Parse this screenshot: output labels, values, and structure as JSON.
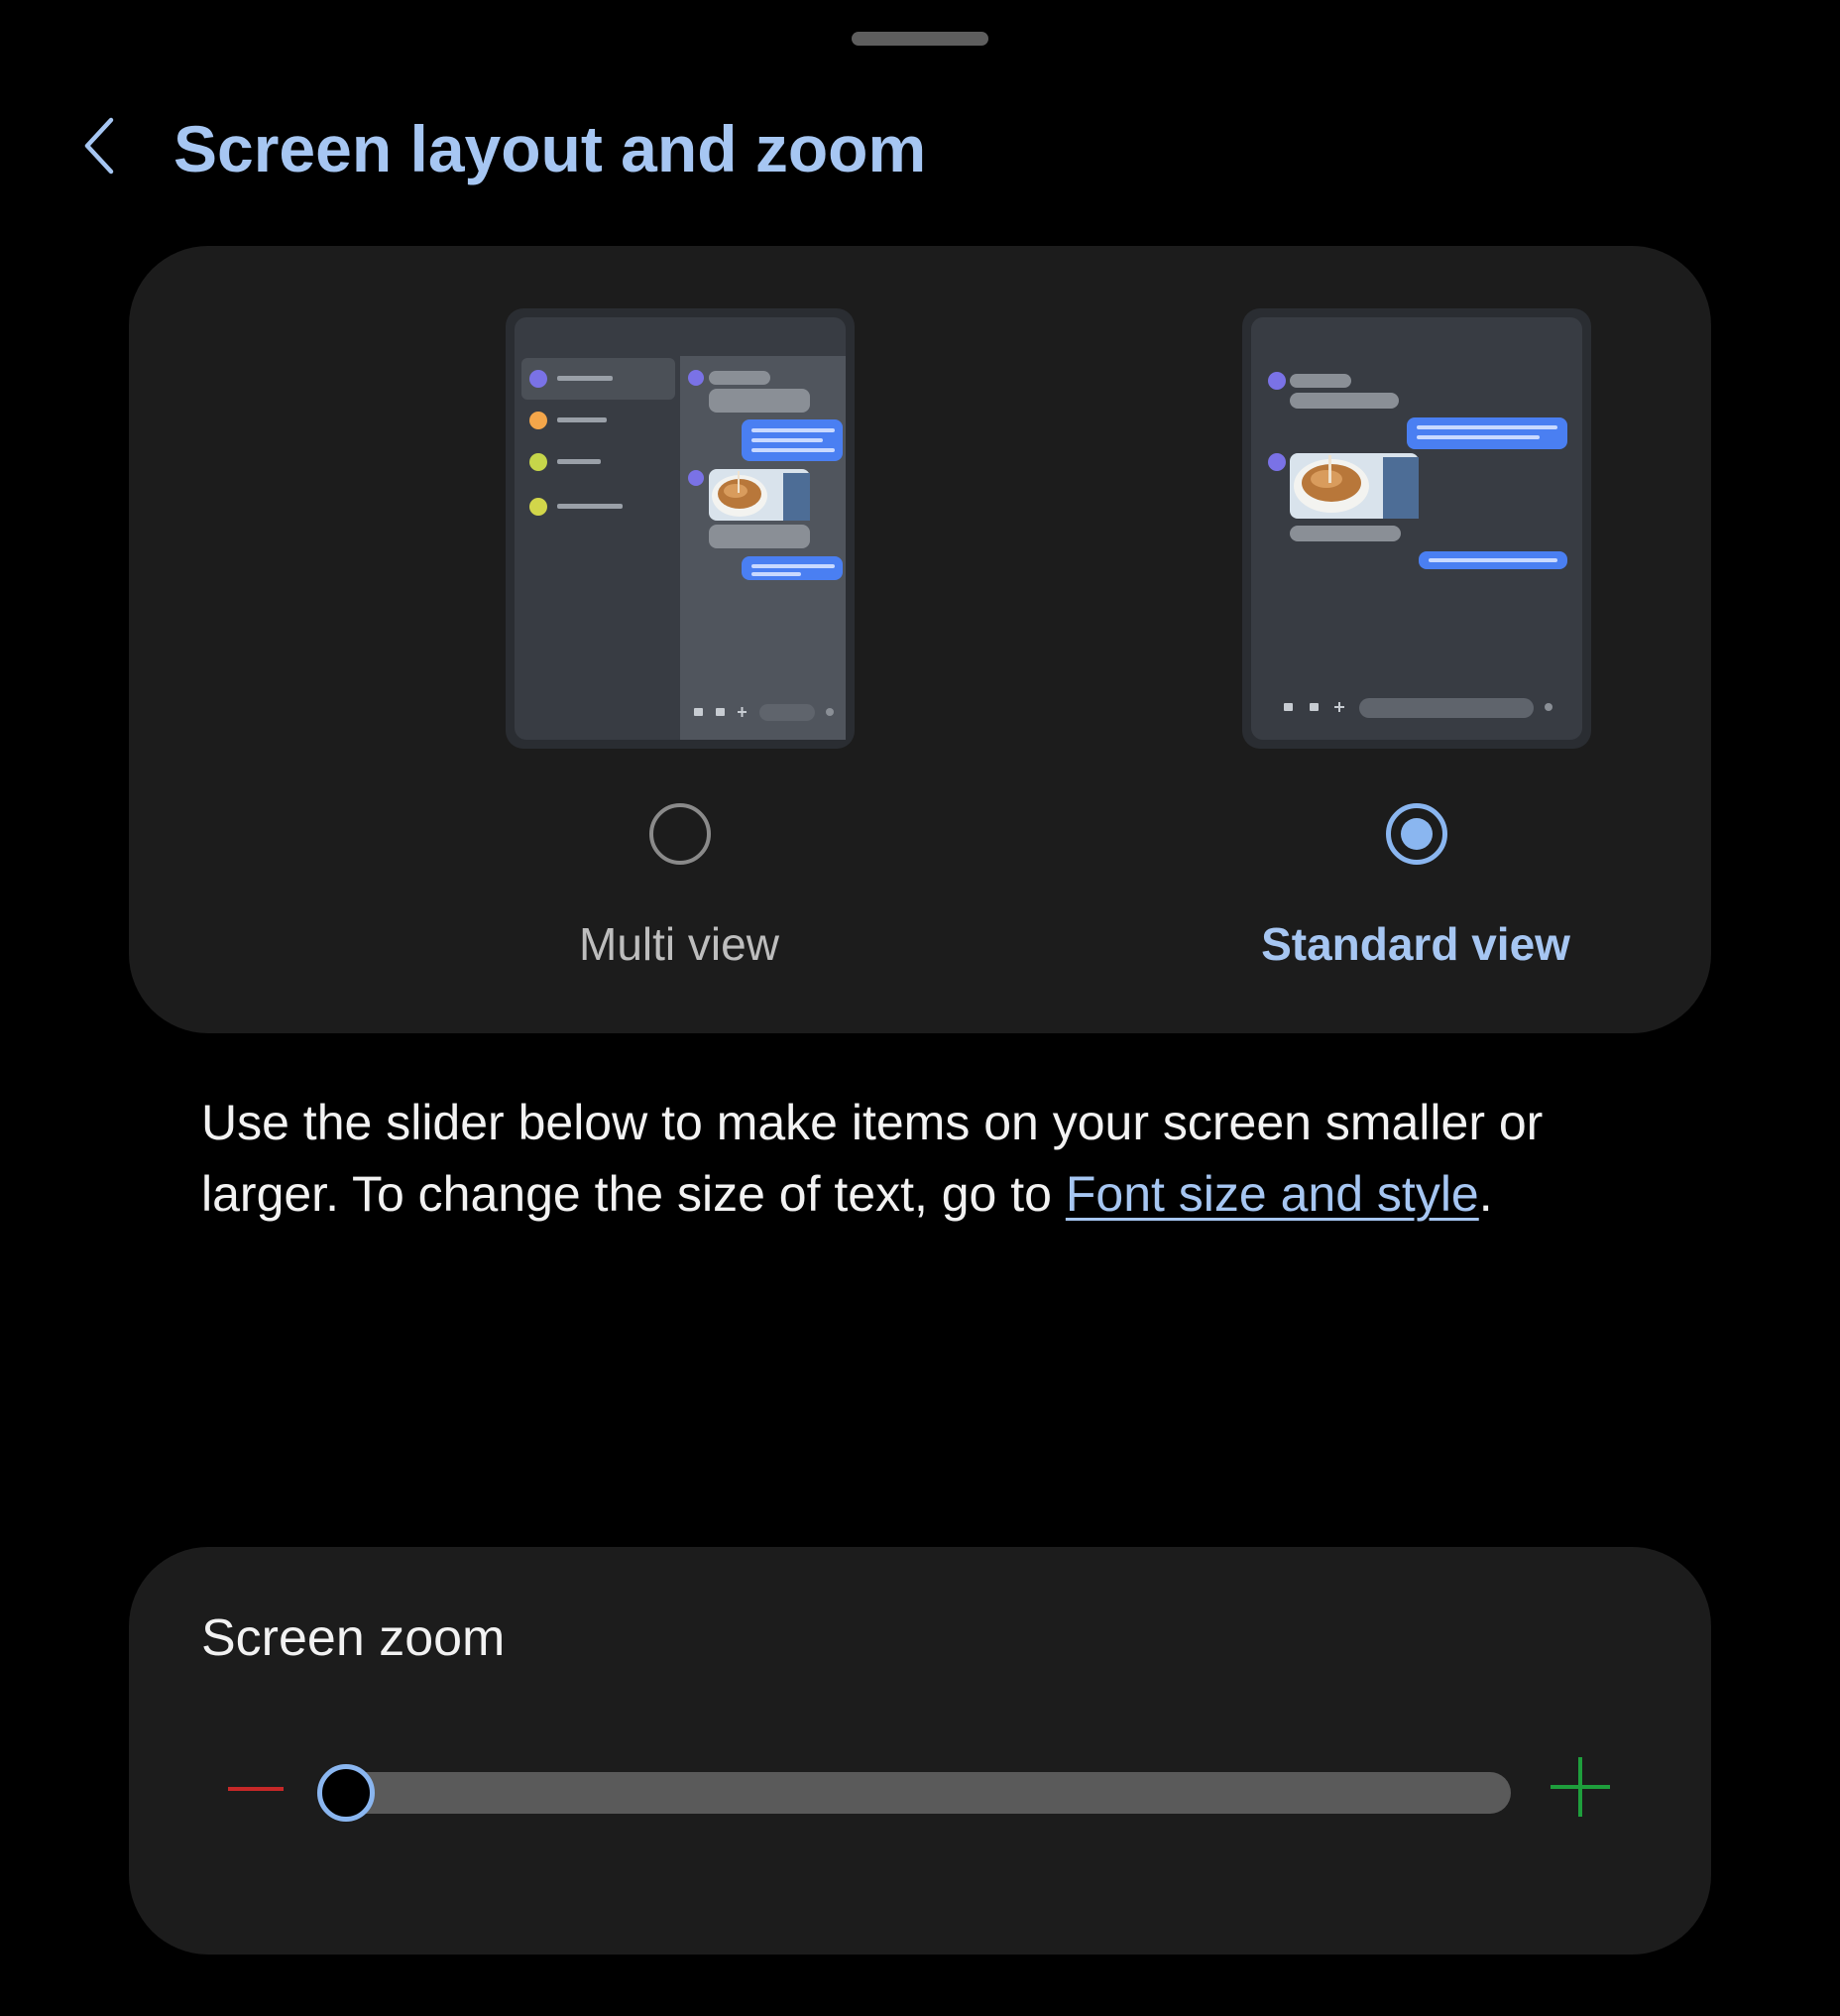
{
  "header": {
    "title": "Screen layout and zoom",
    "back_icon": "chevron-left-icon"
  },
  "layout_options": {
    "multi": {
      "label": "Multi view",
      "selected": false
    },
    "standard": {
      "label": "Standard view",
      "selected": true
    }
  },
  "description": {
    "text_before": "Use the slider below to make items on your screen smaller or larger. To change the size of text, go to ",
    "link_text": "Font size and style",
    "text_after": "."
  },
  "screen_zoom": {
    "title": "Screen zoom",
    "value_fraction": 0,
    "minus_icon": "minus-icon",
    "plus_icon": "plus-icon"
  },
  "colors": {
    "accent": "#8ab6f0",
    "title": "#a6c6f2",
    "card_bg": "#1c1c1c",
    "minus": "#c62828",
    "plus": "#1e9e3c",
    "chat_bubble": "#4a7ff2"
  }
}
